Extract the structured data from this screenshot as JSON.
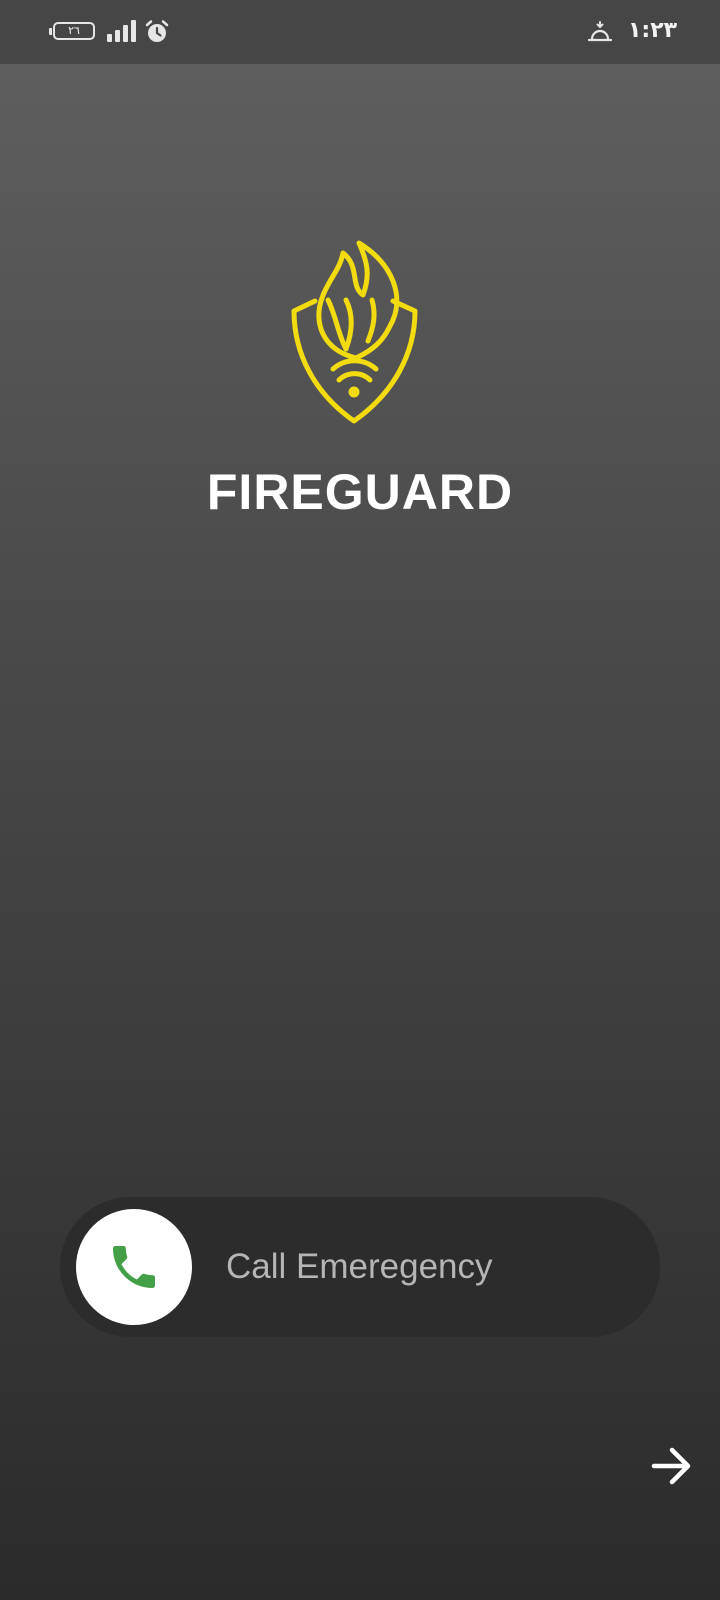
{
  "status_bar": {
    "battery_level": "٢٦",
    "time": "١:٢٣",
    "icons": [
      "battery-icon",
      "signal-icon",
      "alarm-icon",
      "weather-icon"
    ]
  },
  "app": {
    "title": "FIREGUARD",
    "logo_icon": "fireguard-shield-flame-wifi-icon",
    "accent_color": "#f2dc10"
  },
  "call": {
    "label": "Call Emeregency",
    "icon": "phone-icon",
    "icon_color": "#43a047"
  },
  "navigation": {
    "next_icon": "arrow-right-icon"
  }
}
